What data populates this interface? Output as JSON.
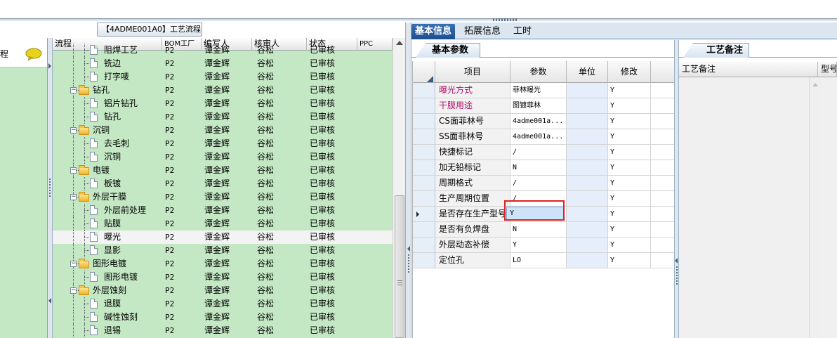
{
  "window": {
    "title_tab": "【4ADME001A0】工艺流程"
  },
  "sidebar": {
    "title": "程"
  },
  "tree": {
    "columns": [
      "流程",
      "BOM工厂",
      "编写人",
      "核审人",
      "状态",
      "PPC"
    ],
    "rows": [
      {
        "type": "leaf",
        "name": "阻焊工艺",
        "bom": "P2",
        "writer": "谭金辉",
        "reviewer": "谷松",
        "status": "已审核"
      },
      {
        "type": "leaf",
        "name": "铣边",
        "bom": "P2",
        "writer": "谭金辉",
        "reviewer": "谷松",
        "status": "已审核"
      },
      {
        "type": "leaf",
        "name": "打字唛",
        "bom": "P2",
        "writer": "谭金辉",
        "reviewer": "谷松",
        "status": "已审核"
      },
      {
        "type": "folder",
        "name": "钻孔",
        "bom": "P2",
        "writer": "谭金辉",
        "reviewer": "谷松",
        "status": "已审核"
      },
      {
        "type": "leaf",
        "name": "铝片钻孔",
        "bom": "P2",
        "writer": "谭金辉",
        "reviewer": "谷松",
        "status": "已审核"
      },
      {
        "type": "leaf",
        "name": "钻孔",
        "bom": "P2",
        "writer": "谭金辉",
        "reviewer": "谷松",
        "status": "已审核"
      },
      {
        "type": "folder",
        "name": "沉铜",
        "bom": "P2",
        "writer": "谭金辉",
        "reviewer": "谷松",
        "status": "已审核"
      },
      {
        "type": "leaf",
        "name": "去毛刺",
        "bom": "P2",
        "writer": "谭金辉",
        "reviewer": "谷松",
        "status": "已审核"
      },
      {
        "type": "leaf",
        "name": "沉铜",
        "bom": "P2",
        "writer": "谭金辉",
        "reviewer": "谷松",
        "status": "已审核"
      },
      {
        "type": "folder",
        "name": "电镀",
        "bom": "P2",
        "writer": "谭金辉",
        "reviewer": "谷松",
        "status": "已审核"
      },
      {
        "type": "leaf",
        "name": "板镀",
        "bom": "P2",
        "writer": "谭金辉",
        "reviewer": "谷松",
        "status": "已审核"
      },
      {
        "type": "folder",
        "name": "外层干膜",
        "bom": "P2",
        "writer": "谭金辉",
        "reviewer": "谷松",
        "status": "已审核"
      },
      {
        "type": "leaf",
        "name": "外层前处理",
        "bom": "P2",
        "writer": "谭金辉",
        "reviewer": "谷松",
        "status": "已审核"
      },
      {
        "type": "leaf",
        "name": "贴膜",
        "bom": "P2",
        "writer": "谭金辉",
        "reviewer": "谷松",
        "status": "已审核"
      },
      {
        "type": "leaf",
        "name": "曝光",
        "bom": "P2",
        "writer": "谭金辉",
        "reviewer": "谷松",
        "status": "已审核",
        "selected": true
      },
      {
        "type": "leaf",
        "name": "显影",
        "bom": "P2",
        "writer": "谭金辉",
        "reviewer": "谷松",
        "status": "已审核"
      },
      {
        "type": "folder",
        "name": "图形电镀",
        "bom": "P2",
        "writer": "谭金辉",
        "reviewer": "谷松",
        "status": "已审核"
      },
      {
        "type": "leaf",
        "name": "图形电镀",
        "bom": "P2",
        "writer": "谭金辉",
        "reviewer": "谷松",
        "status": "已审核"
      },
      {
        "type": "folder",
        "name": "外层蚀刻",
        "bom": "P2",
        "writer": "谭金辉",
        "reviewer": "谷松",
        "status": "已审核"
      },
      {
        "type": "leaf",
        "name": "退膜",
        "bom": "P2",
        "writer": "谭金辉",
        "reviewer": "谷松",
        "status": "已审核"
      },
      {
        "type": "leaf",
        "name": "碱性蚀刻",
        "bom": "P2",
        "writer": "谭金辉",
        "reviewer": "谷松",
        "status": "已审核"
      },
      {
        "type": "leaf",
        "name": "退锡",
        "bom": "P2",
        "writer": "谭金辉",
        "reviewer": "谷松",
        "status": "已审核"
      }
    ]
  },
  "tabs": [
    "基本信息",
    "拓展信息",
    "工时"
  ],
  "params": {
    "tab_label": "基本参数",
    "columns": [
      "项目",
      "参数",
      "单位",
      "修改"
    ],
    "rows": [
      {
        "item": "曝光方式",
        "value": "菲林曝光",
        "unit": "",
        "mod": "Y",
        "pink": true
      },
      {
        "item": "干膜用途",
        "value": "图镀菲林",
        "unit": "",
        "mod": "Y",
        "pink": true
      },
      {
        "item": "CS面菲林号",
        "value": "4adme001a...",
        "unit": "",
        "mod": "Y"
      },
      {
        "item": "SS面菲林号",
        "value": "4adme001a...",
        "unit": "",
        "mod": "Y"
      },
      {
        "item": "快捷标记",
        "value": "/",
        "unit": "",
        "mod": "Y"
      },
      {
        "item": "加无铅标记",
        "value": "N",
        "unit": "",
        "mod": "Y"
      },
      {
        "item": "周期格式",
        "value": "/",
        "unit": "",
        "mod": "Y"
      },
      {
        "item": "生产周期位置",
        "value": "/",
        "unit": "",
        "mod": "Y"
      },
      {
        "item": "是否存在生产型号",
        "value": "Y",
        "unit": "",
        "mod": "Y",
        "current": true
      },
      {
        "item": "是否有负焊盘",
        "value": "N",
        "unit": "",
        "mod": "Y"
      },
      {
        "item": "外层动态补偿",
        "value": "Y",
        "unit": "",
        "mod": "Y"
      },
      {
        "item": "定位孔",
        "value": "LO",
        "unit": "",
        "mod": "Y"
      }
    ]
  },
  "notes": {
    "tab_label": "工艺备注",
    "columns": [
      "工艺备注",
      "型号"
    ]
  },
  "colors": {
    "tree_bg": "#c4e7c4",
    "tab_active": "#1b4f92",
    "pink_text": "#b0146e",
    "highlight": "#e02020"
  }
}
